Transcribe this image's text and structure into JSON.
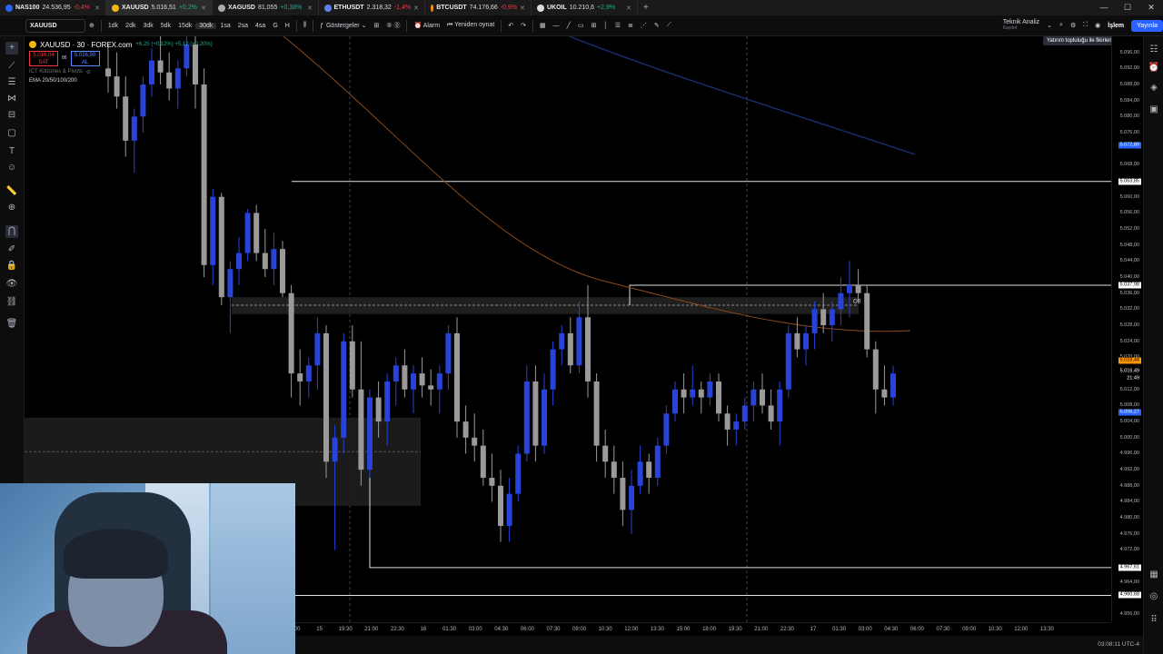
{
  "tabs": [
    {
      "symbol": "NAS100",
      "price": "24.536,95",
      "change": "-0,4%",
      "dir": "dn",
      "color": "#2962ff"
    },
    {
      "symbol": "XAUUSD",
      "price": "5.016,51",
      "change": "+0,2%",
      "dir": "up",
      "color": "#f0b90b",
      "active": true
    },
    {
      "symbol": "XAGUSD",
      "price": "81,055",
      "change": "+0,38%",
      "dir": "up",
      "color": "#aaaaaa"
    },
    {
      "symbol": "ETHUSDT",
      "price": "2.318,32",
      "change": "-1,4%",
      "dir": "dn",
      "color": "#627eea"
    },
    {
      "symbol": "BTCUSDT",
      "price": "74.176,66",
      "change": "-0,9%",
      "dir": "dn",
      "color": "#f7931a"
    },
    {
      "symbol": "UKOIL",
      "price": "10.210,6",
      "change": "+2,9%",
      "dir": "up",
      "color": "#dddddd"
    }
  ],
  "toolbar": {
    "symbol": "XAUUSD",
    "intervals": [
      "1dk",
      "2dk",
      "3dk",
      "5dk",
      "15dk",
      "30dk",
      "1sa",
      "2sa",
      "4sa",
      "G",
      "H"
    ],
    "selected_interval": "30dk",
    "indicators_label": "Göstergeler",
    "alert_label": "Alarm",
    "replay_label": "Yeniden oynat",
    "analysis_label": "Teknik Analiz",
    "analysis_sub": "Kaydet",
    "trade_label": "İşlem",
    "publish_label": "Yayınla",
    "tooltip": "Yatırım topluluğu ile fikirlerinizi paylaşın"
  },
  "legend": {
    "title": "XAUUSD · 30 · FOREX.com",
    "ohlc": "+6,25 (+0,12%) +5,12 (+0,20%)",
    "sell_price": "5.016,04",
    "sell_label": "SAT",
    "spread": "86",
    "buy_price": "5.016,90",
    "buy_label": "AL",
    "ind1": "ICT Killzones & Pivots",
    "ind2": "EMA 20/50/100/200"
  },
  "chart_data": {
    "type": "candlestick",
    "y_range": [
      4954,
      5100
    ],
    "price_ticks": [
      "5.096,00",
      "5.092,00",
      "5.088,00",
      "5.084,00",
      "5.080,00",
      "5.076,00",
      "5.068,00",
      "5.060,00",
      "5.056,00",
      "5.052,00",
      "5.048,00",
      "5.044,00",
      "5.040,00",
      "5.036,00",
      "5.032,00",
      "5.028,00",
      "5.024,00",
      "5.020,00",
      "5.012,00",
      "5.008,00",
      "5.004,00",
      "5.000,00",
      "4.996,00",
      "4.992,00",
      "4.988,00",
      "4.984,00",
      "4.980,00",
      "4.976,00",
      "4.972,00",
      "4.964,00",
      "4.956,00"
    ],
    "price_labels": [
      {
        "text": "5.072,89",
        "value": 5072.89,
        "bg": "#2962ff",
        "fg": "#ffffff"
      },
      {
        "text": "5.063,85",
        "value": 5063.85,
        "bg": "#ffffff",
        "fg": "#000000"
      },
      {
        "text": "5.037,98",
        "value": 5037.98,
        "bg": "#ffffff",
        "fg": "#000000"
      },
      {
        "text": "5.018,44",
        "value": 5019.3,
        "bg": "#ff9800",
        "fg": "#000000"
      },
      {
        "text": "5.016,49",
        "value": 5016.4,
        "bg": "#000000",
        "fg": "#ffffff"
      },
      {
        "text": "21:49",
        "value": 5014.6,
        "bg": "#000000",
        "fg": "#ffffff"
      },
      {
        "text": "5.006,27",
        "value": 5006.27,
        "bg": "#2962ff",
        "fg": "#ffffff"
      },
      {
        "text": "4.967,61",
        "value": 4967.61,
        "bg": "#ffffff",
        "fg": "#000000"
      },
      {
        "text": "4.960,68",
        "value": 4960.68,
        "bg": "#ffffff",
        "fg": "#000000"
      }
    ],
    "time_ticks": [
      "15:00",
      "15",
      "19:30",
      "21:00",
      "22:30",
      "16",
      "01:30",
      "03:00",
      "04:30",
      "06:00",
      "07:30",
      "09:00",
      "10:30",
      "12:00",
      "13:30",
      "15:00",
      "18:00",
      "19:30",
      "21:00",
      "22:30",
      "17",
      "01:30",
      "03:00",
      "04:30",
      "06:00",
      "07:30",
      "09:00",
      "10:30",
      "12:00",
      "13:30"
    ],
    "candles": [
      {
        "o": 5092,
        "h": 5098,
        "l": 5086,
        "c": 5090
      },
      {
        "o": 5090,
        "h": 5096,
        "l": 5082,
        "c": 5085
      },
      {
        "o": 5085,
        "h": 5090,
        "l": 5070,
        "c": 5074
      },
      {
        "o": 5074,
        "h": 5082,
        "l": 5066,
        "c": 5080
      },
      {
        "o": 5080,
        "h": 5090,
        "l": 5076,
        "c": 5088
      },
      {
        "o": 5088,
        "h": 5097,
        "l": 5085,
        "c": 5094
      },
      {
        "o": 5094,
        "h": 5100,
        "l": 5088,
        "c": 5091
      },
      {
        "o": 5091,
        "h": 5096,
        "l": 5084,
        "c": 5087
      },
      {
        "o": 5087,
        "h": 5094,
        "l": 5082,
        "c": 5092
      },
      {
        "o": 5092,
        "h": 5100,
        "l": 5090,
        "c": 5098
      },
      {
        "o": 5098,
        "h": 5100,
        "l": 5082,
        "c": 5088
      },
      {
        "o": 5088,
        "h": 5092,
        "l": 5040,
        "c": 5043
      },
      {
        "o": 5043,
        "h": 5062,
        "l": 5038,
        "c": 5060
      },
      {
        "o": 5060,
        "h": 5061,
        "l": 5033,
        "c": 5035
      },
      {
        "o": 5035,
        "h": 5044,
        "l": 5026,
        "c": 5042
      },
      {
        "o": 5042,
        "h": 5050,
        "l": 5038,
        "c": 5046
      },
      {
        "o": 5046,
        "h": 5057,
        "l": 5044,
        "c": 5056
      },
      {
        "o": 5056,
        "h": 5058,
        "l": 5044,
        "c": 5046
      },
      {
        "o": 5046,
        "h": 5052,
        "l": 5040,
        "c": 5042
      },
      {
        "o": 5042,
        "h": 5051,
        "l": 5038,
        "c": 5047
      },
      {
        "o": 5047,
        "h": 5049,
        "l": 5035,
        "c": 5036
      },
      {
        "o": 5036,
        "h": 5038,
        "l": 5010,
        "c": 5016
      },
      {
        "o": 5016,
        "h": 5022,
        "l": 5008,
        "c": 5014
      },
      {
        "o": 5014,
        "h": 5020,
        "l": 5010,
        "c": 5018
      },
      {
        "o": 5018,
        "h": 5030,
        "l": 5012,
        "c": 5026
      },
      {
        "o": 5026,
        "h": 5028,
        "l": 4990,
        "c": 4994
      },
      {
        "o": 4994,
        "h": 5003,
        "l": 4972,
        "c": 5000
      },
      {
        "o": 5000,
        "h": 5026,
        "l": 4996,
        "c": 5024
      },
      {
        "o": 5024,
        "h": 5028,
        "l": 5010,
        "c": 5012
      },
      {
        "o": 5012,
        "h": 5024,
        "l": 4988,
        "c": 4992
      },
      {
        "o": 4992,
        "h": 5012,
        "l": 4990,
        "c": 5010
      },
      {
        "o": 5010,
        "h": 5014,
        "l": 5000,
        "c": 5004
      },
      {
        "o": 5004,
        "h": 5016,
        "l": 4998,
        "c": 5014
      },
      {
        "o": 5014,
        "h": 5020,
        "l": 5008,
        "c": 5018
      },
      {
        "o": 5018,
        "h": 5022,
        "l": 5010,
        "c": 5012
      },
      {
        "o": 5012,
        "h": 5018,
        "l": 5006,
        "c": 5016
      },
      {
        "o": 5016,
        "h": 5020,
        "l": 5010,
        "c": 5013
      },
      {
        "o": 5013,
        "h": 5017,
        "l": 5008,
        "c": 5012
      },
      {
        "o": 5012,
        "h": 5018,
        "l": 5006,
        "c": 5016
      },
      {
        "o": 5016,
        "h": 5028,
        "l": 5012,
        "c": 5026
      },
      {
        "o": 5026,
        "h": 5030,
        "l": 5000,
        "c": 5004
      },
      {
        "o": 5004,
        "h": 5008,
        "l": 4996,
        "c": 5000
      },
      {
        "o": 5000,
        "h": 5006,
        "l": 4994,
        "c": 4998
      },
      {
        "o": 4998,
        "h": 5002,
        "l": 4988,
        "c": 4990
      },
      {
        "o": 4990,
        "h": 4996,
        "l": 4984,
        "c": 4988
      },
      {
        "o": 4988,
        "h": 4992,
        "l": 4974,
        "c": 4978
      },
      {
        "o": 4978,
        "h": 4990,
        "l": 4974,
        "c": 4986
      },
      {
        "o": 4986,
        "h": 4998,
        "l": 4984,
        "c": 4996
      },
      {
        "o": 4996,
        "h": 5018,
        "l": 4994,
        "c": 5014
      },
      {
        "o": 5014,
        "h": 5018,
        "l": 4994,
        "c": 4998
      },
      {
        "o": 4998,
        "h": 5016,
        "l": 4996,
        "c": 5012
      },
      {
        "o": 5012,
        "h": 5024,
        "l": 5008,
        "c": 5022
      },
      {
        "o": 5022,
        "h": 5028,
        "l": 5018,
        "c": 5026
      },
      {
        "o": 5026,
        "h": 5030,
        "l": 5016,
        "c": 5018
      },
      {
        "o": 5018,
        "h": 5034,
        "l": 5016,
        "c": 5030
      },
      {
        "o": 5030,
        "h": 5038,
        "l": 5010,
        "c": 5014
      },
      {
        "o": 5014,
        "h": 5016,
        "l": 4994,
        "c": 4998
      },
      {
        "o": 4998,
        "h": 5002,
        "l": 4990,
        "c": 4994
      },
      {
        "o": 4994,
        "h": 4998,
        "l": 4986,
        "c": 4990
      },
      {
        "o": 4990,
        "h": 4994,
        "l": 4978,
        "c": 4982
      },
      {
        "o": 4982,
        "h": 4992,
        "l": 4976,
        "c": 4988
      },
      {
        "o": 4988,
        "h": 4998,
        "l": 4986,
        "c": 4994
      },
      {
        "o": 4994,
        "h": 4996,
        "l": 4986,
        "c": 4990
      },
      {
        "o": 4990,
        "h": 5000,
        "l": 4988,
        "c": 4998
      },
      {
        "o": 4998,
        "h": 5008,
        "l": 4996,
        "c": 5006
      },
      {
        "o": 5006,
        "h": 5014,
        "l": 5004,
        "c": 5012
      },
      {
        "o": 5012,
        "h": 5016,
        "l": 5006,
        "c": 5010
      },
      {
        "o": 5010,
        "h": 5018,
        "l": 5008,
        "c": 5012
      },
      {
        "o": 5012,
        "h": 5014,
        "l": 5006,
        "c": 5010
      },
      {
        "o": 5010,
        "h": 5016,
        "l": 5008,
        "c": 5014
      },
      {
        "o": 5014,
        "h": 5016,
        "l": 5004,
        "c": 5006
      },
      {
        "o": 5006,
        "h": 5008,
        "l": 4998,
        "c": 5002
      },
      {
        "o": 5002,
        "h": 5006,
        "l": 4998,
        "c": 5004
      },
      {
        "o": 5004,
        "h": 5010,
        "l": 5002,
        "c": 5008
      },
      {
        "o": 5008,
        "h": 5014,
        "l": 5004,
        "c": 5012
      },
      {
        "o": 5012,
        "h": 5016,
        "l": 5006,
        "c": 5008
      },
      {
        "o": 5008,
        "h": 5012,
        "l": 5002,
        "c": 5004
      },
      {
        "o": 5004,
        "h": 5014,
        "l": 4998,
        "c": 5012
      },
      {
        "o": 5012,
        "h": 5028,
        "l": 5010,
        "c": 5026
      },
      {
        "o": 5026,
        "h": 5030,
        "l": 5020,
        "c": 5022
      },
      {
        "o": 5022,
        "h": 5028,
        "l": 5018,
        "c": 5026
      },
      {
        "o": 5026,
        "h": 5034,
        "l": 5022,
        "c": 5032
      },
      {
        "o": 5032,
        "h": 5036,
        "l": 5026,
        "c": 5028
      },
      {
        "o": 5028,
        "h": 5034,
        "l": 5024,
        "c": 5032
      },
      {
        "o": 5032,
        "h": 5040,
        "l": 5028,
        "c": 5036
      },
      {
        "o": 5036,
        "h": 5044,
        "l": 5030,
        "c": 5038
      },
      {
        "o": 5038,
        "h": 5042,
        "l": 5034,
        "c": 5036
      },
      {
        "o": 5036,
        "h": 5038,
        "l": 5020,
        "c": 5022
      },
      {
        "o": 5022,
        "h": 5024,
        "l": 5006,
        "c": 5012
      },
      {
        "o": 5012,
        "h": 5018,
        "l": 5008,
        "c": 5010
      },
      {
        "o": 5010,
        "h": 5018,
        "l": 5008,
        "c": 5016
      }
    ]
  },
  "bottom": {
    "clock": "03:08:11 UTC-4"
  }
}
